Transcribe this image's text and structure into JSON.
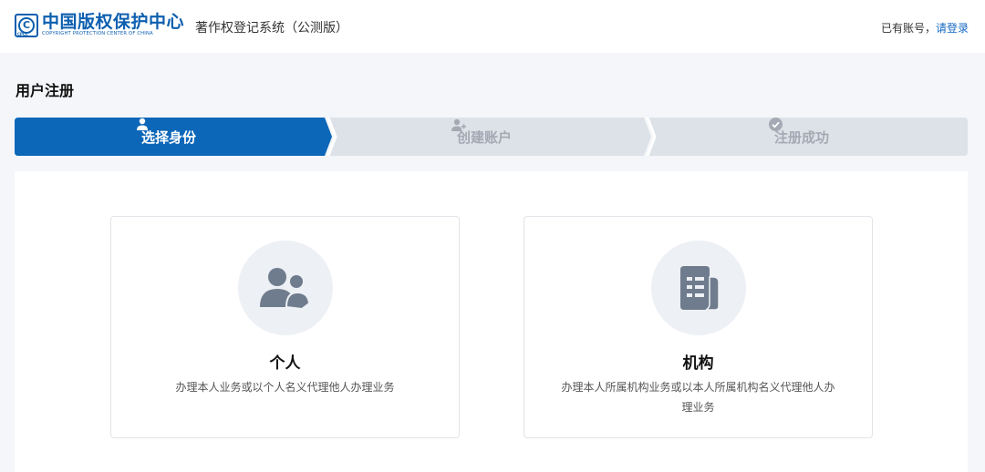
{
  "header": {
    "logo_cn": "中国版权保护中心",
    "logo_en": "COPYRIGHT PROTECTION CENTER OF CHINA",
    "logo_mark": "C",
    "logo_mark_sub": "CPCC",
    "system_title": "著作权登记系统（公测版）",
    "account_prefix": "已有账号，",
    "login_link": "请登录"
  },
  "page": {
    "title": "用户注册"
  },
  "steps": [
    {
      "label": "选择身份",
      "icon": "user-icon",
      "state": "active"
    },
    {
      "label": "创建账户",
      "icon": "user-add-icon",
      "state": "pending"
    },
    {
      "label": "注册成功",
      "icon": "check-circle-icon",
      "state": "pending"
    }
  ],
  "cards": [
    {
      "title": "个人",
      "description": "办理本人业务或以个人名义代理他人办理业务",
      "icon": "users-icon"
    },
    {
      "title": "机构",
      "description": "办理本人所属机构业务或以本人所属机构名义代理他人办理业务",
      "icon": "document-icon"
    }
  ],
  "colors": {
    "primary": "#0d67b8",
    "step_inactive": "#dde2e8",
    "icon_gray": "#6f7c8e",
    "background": "#f4f6f9"
  }
}
